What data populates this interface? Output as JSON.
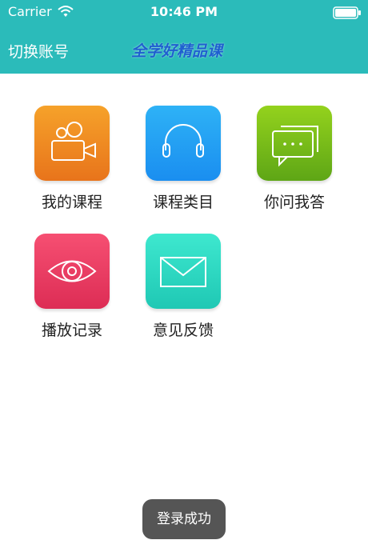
{
  "status_bar": {
    "carrier": "Carrier",
    "time": "10:46 PM"
  },
  "nav": {
    "left_label": "切换账号",
    "logo_text": "全学好精品课"
  },
  "tiles": [
    {
      "label": "我的课程",
      "icon": "video-camera-icon",
      "color_top": "#f6a22a",
      "color_bottom": "#e8741b"
    },
    {
      "label": "课程类目",
      "icon": "headphones-icon",
      "color_top": "#2eb2f6",
      "color_bottom": "#1a8ef0"
    },
    {
      "label": "你问我答",
      "icon": "chat-bubbles-icon",
      "color_top": "#94d21d",
      "color_bottom": "#5ea616"
    },
    {
      "label": "播放记录",
      "icon": "eye-icon",
      "color_top": "#f64f72",
      "color_bottom": "#dd2d55"
    },
    {
      "label": "意见反馈",
      "icon": "envelope-icon",
      "color_top": "#3ee8cf",
      "color_bottom": "#1fc8b4"
    }
  ],
  "toast": {
    "text": "登录成功"
  },
  "colors": {
    "header": "#2bbbba",
    "toast_bg": "#555555"
  }
}
